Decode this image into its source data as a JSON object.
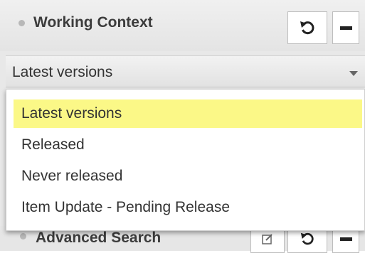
{
  "working_context": {
    "title": "Working Context",
    "selected_value": "Latest versions",
    "options": [
      {
        "label": "Latest versions",
        "highlighted": true
      },
      {
        "label": "Released",
        "highlighted": false
      },
      {
        "label": "Never released",
        "highlighted": false
      },
      {
        "label": "Item Update - Pending Release",
        "highlighted": false
      }
    ],
    "icons": {
      "bullet": "bullet-icon",
      "refresh": "refresh-icon",
      "minimize": "minimize-icon",
      "caret": "chevron-down-icon"
    }
  },
  "advanced_search": {
    "title": "Advanced Search",
    "icons": {
      "edit": "edit-icon",
      "refresh": "refresh-icon",
      "minimize": "minimize-icon"
    }
  },
  "colors": {
    "highlight": "#fbf887",
    "header_bg": "#e8e8e8",
    "text": "#333333"
  }
}
